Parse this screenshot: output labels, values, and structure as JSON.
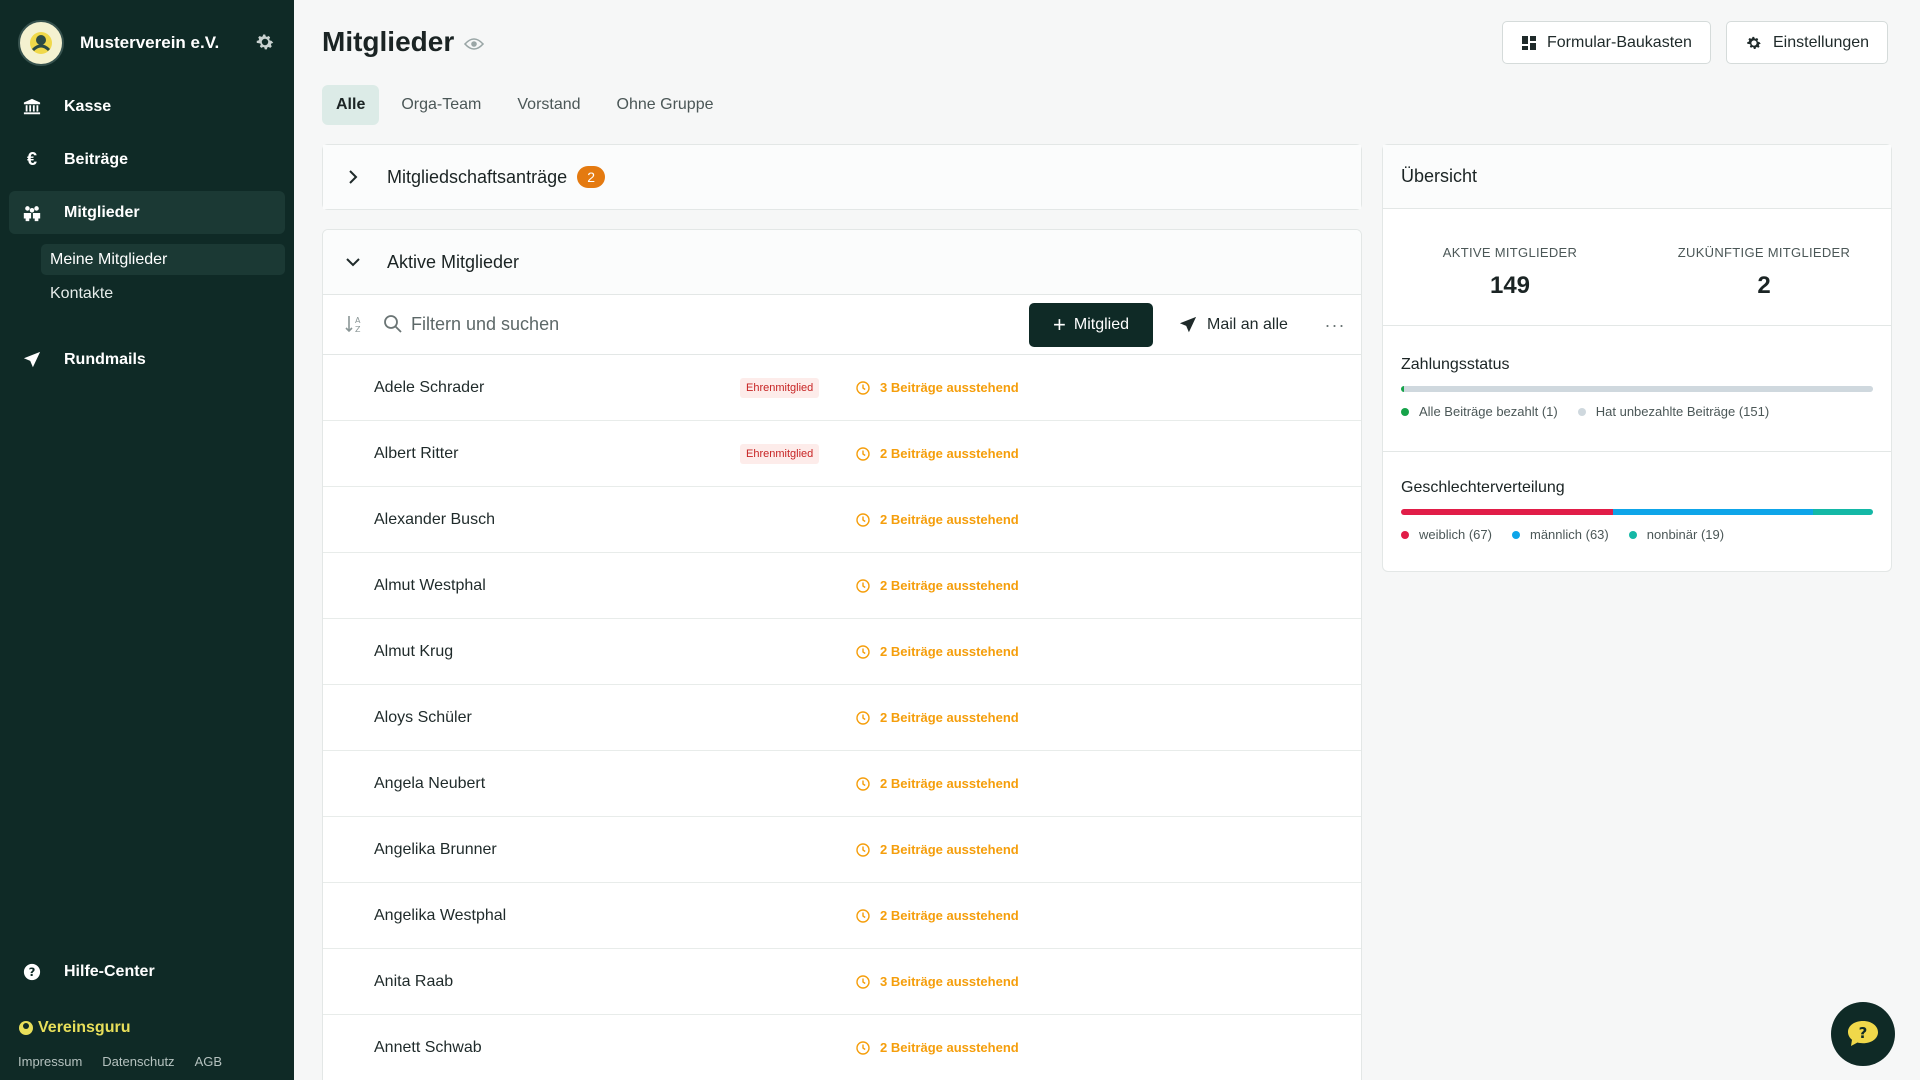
{
  "sidebar": {
    "org_name": "Musterverein e.V.",
    "nav": {
      "kasse": "Kasse",
      "beitraege": "Beiträge",
      "mitglieder": "Mitglieder",
      "meine_mitglieder": "Meine Mitglieder",
      "kontakte": "Kontakte",
      "rundmails": "Rundmails",
      "hilfe": "Hilfe-Center"
    },
    "brand": "Vereinsguru",
    "footer": [
      "Impressum",
      "Datenschutz",
      "AGB"
    ]
  },
  "header": {
    "title": "Mitglieder",
    "formular_button": "Formular-Baukasten",
    "einstellungen_button": "Einstellungen"
  },
  "tabs": [
    "Alle",
    "Orga-Team",
    "Vorstand",
    "Ohne Gruppe"
  ],
  "applications": {
    "label": "Mitgliedschaftsanträge",
    "count": "2"
  },
  "active_members": {
    "label": "Aktive Mitglieder",
    "search_placeholder": "Filtern und suchen",
    "add_button": "Mitglied",
    "mail_button": "Mail an alle",
    "more": "···",
    "rows": [
      {
        "name": "Adele Schrader",
        "tag": "Ehrenmitglied",
        "status": "3 Beiträge ausstehend"
      },
      {
        "name": "Albert Ritter",
        "tag": "Ehrenmitglied",
        "status": "2 Beiträge ausstehend"
      },
      {
        "name": "Alexander Busch",
        "tag": "",
        "status": "2 Beiträge ausstehend"
      },
      {
        "name": "Almut Westphal",
        "tag": "",
        "status": "2 Beiträge ausstehend"
      },
      {
        "name": "Almut Krug",
        "tag": "",
        "status": "2 Beiträge ausstehend"
      },
      {
        "name": "Aloys Schüler",
        "tag": "",
        "status": "2 Beiträge ausstehend"
      },
      {
        "name": "Angela Neubert",
        "tag": "",
        "status": "2 Beiträge ausstehend"
      },
      {
        "name": "Angelika Brunner",
        "tag": "",
        "status": "2 Beiträge ausstehend"
      },
      {
        "name": "Angelika Westphal",
        "tag": "",
        "status": "2 Beiträge ausstehend"
      },
      {
        "name": "Anita Raab",
        "tag": "",
        "status": "3 Beiträge ausstehend"
      },
      {
        "name": "Annett Schwab",
        "tag": "",
        "status": "2 Beiträge ausstehend"
      }
    ]
  },
  "overview": {
    "title": "Übersicht",
    "active_label": "AKTIVE MITGLIEDER",
    "active_value": "149",
    "future_label": "ZUKÜNFTIGE MITGLIEDER",
    "future_value": "2",
    "payment": {
      "title": "Zahlungsstatus",
      "paid_label": "Alle Beiträge bezahlt (1)",
      "unpaid_label": "Hat unbezahlte Beiträge (151)",
      "paid": 1,
      "unpaid": 151,
      "paid_color": "#16a34a",
      "unpaid_color": "#cfd8de"
    },
    "gender": {
      "title": "Geschlechterverteilung",
      "segments": [
        {
          "label": "weiblich (67)",
          "value": 67,
          "color": "#e11d48"
        },
        {
          "label": "männlich (63)",
          "value": 63,
          "color": "#0ea5e9"
        },
        {
          "label": "nonbinär (19)",
          "value": 19,
          "color": "#14b8a6"
        }
      ]
    }
  },
  "colors": {
    "sidebar_bg": "#0f2a26",
    "accent_orange": "#e47a10",
    "status_amber": "#f59e0b",
    "tag_red": "#c72424"
  }
}
